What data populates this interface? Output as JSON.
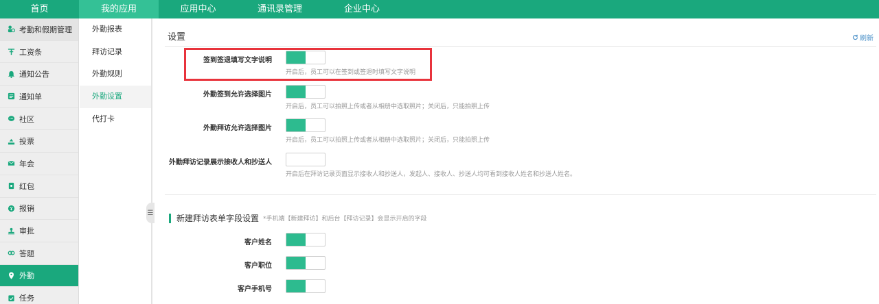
{
  "topnav": {
    "tabs": [
      {
        "label": "首页",
        "width": 115,
        "active": false
      },
      {
        "label": "我的应用",
        "width": 116,
        "active": true
      },
      {
        "label": "应用中心",
        "width": 115,
        "active": false
      },
      {
        "label": "通讯录管理",
        "width": 123,
        "active": false
      },
      {
        "label": "企业中心",
        "width": 116,
        "active": false
      }
    ]
  },
  "sidebar": {
    "items": [
      {
        "label": "考勤和假期管理",
        "icon": "clock-person-icon"
      },
      {
        "label": "工资条",
        "icon": "salary-icon"
      },
      {
        "label": "通知公告",
        "icon": "bell-icon"
      },
      {
        "label": "通知单",
        "icon": "notice-list-icon"
      },
      {
        "label": "社区",
        "icon": "chat-bubble-icon"
      },
      {
        "label": "投票",
        "icon": "vote-icon"
      },
      {
        "label": "年会",
        "icon": "envelope-icon"
      },
      {
        "label": "红包",
        "icon": "red-packet-icon"
      },
      {
        "label": "报销",
        "icon": "yen-icon"
      },
      {
        "label": "审批",
        "icon": "stamp-icon"
      },
      {
        "label": "答题",
        "icon": "link-icon"
      },
      {
        "label": "外勤",
        "icon": "location-pin-icon"
      },
      {
        "label": "任务",
        "icon": "task-icon"
      }
    ]
  },
  "subnav": {
    "items": [
      {
        "label": "外勤报表"
      },
      {
        "label": "拜访记录"
      },
      {
        "label": "外勤规则"
      },
      {
        "label": "外勤设置"
      },
      {
        "label": "代打卡"
      }
    ]
  },
  "main": {
    "title": "设置",
    "refresh_label": "刷新",
    "settings": [
      {
        "label": "签到签退填写文字说明",
        "on": true,
        "desc": "开启后，员工可以在签到或签退时填写文字说明"
      },
      {
        "label": "外勤签到允许选择图片",
        "on": true,
        "desc": "开启后，员工可以拍照上传或者从相册中选取照片；关闭后，只能拍照上传"
      },
      {
        "label": "外勤拜访允许选择图片",
        "on": true,
        "desc": "开启后，员工可以拍照上传或者从相册中选取照片；关闭后，只能拍照上传"
      },
      {
        "label": "外勤拜访记录展示接收人和抄送人",
        "on": false,
        "desc": "开启后在拜访记录页面显示接收人和抄送人，发起人、接收人、抄送人均可看到接收人姓名和抄送人姓名。"
      }
    ],
    "section": {
      "title": "新建拜访表单字段设置",
      "note": "*手机端【新建拜访】和后台【拜访记录】会显示开启的字段"
    },
    "fields": [
      {
        "label": "客户姓名",
        "on": true
      },
      {
        "label": "客户职位",
        "on": true
      },
      {
        "label": "客户手机号",
        "on": true
      }
    ]
  },
  "colors": {
    "brand": "#1aa87d",
    "toggle_on": "#2dbb8f",
    "highlight": "#e8333c",
    "link": "#4a90c8"
  }
}
